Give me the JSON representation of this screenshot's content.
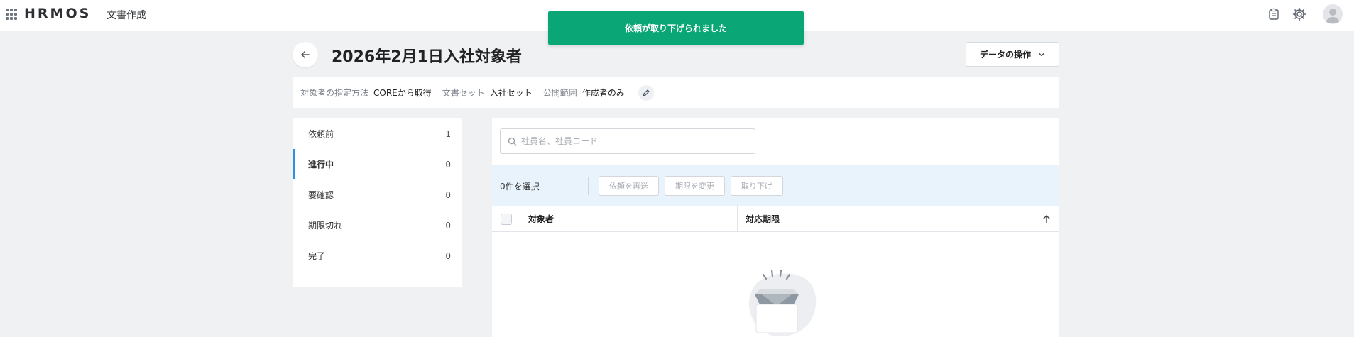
{
  "header": {
    "logo": "HRMOS",
    "product": "文書作成",
    "icons": [
      "apps-grid-icon",
      "clipboard-icon",
      "gear-icon",
      "user-avatar-icon"
    ]
  },
  "toast": {
    "message": "依頼が取り下げられました",
    "color": "#0aa675"
  },
  "page": {
    "title": "2026年2月1日入社対象者",
    "data_ops_label": "データの操作"
  },
  "meta": {
    "target_method_label": "対象者の指定方法",
    "target_method_value": "COREから取得",
    "docset_label": "文書セット",
    "docset_value": "入社セット",
    "visibility_label": "公開範囲",
    "visibility_value": "作成者のみ"
  },
  "sidebar": {
    "items": [
      {
        "label": "依頼前",
        "count": "1"
      },
      {
        "label": "進行中",
        "count": "0"
      },
      {
        "label": "要確認",
        "count": "0"
      },
      {
        "label": "期限切れ",
        "count": "0"
      },
      {
        "label": "完了",
        "count": "0"
      }
    ],
    "active_color": "#2f8ee6"
  },
  "main": {
    "search_placeholder": "社員名、社員コード",
    "selected_text": "0件を選択",
    "buttons": {
      "resend": "依頼を再送",
      "change_deadline": "期限を変更",
      "withdraw": "取り下げ"
    },
    "columns": {
      "target": "対象者",
      "deadline": "対応期限"
    }
  }
}
